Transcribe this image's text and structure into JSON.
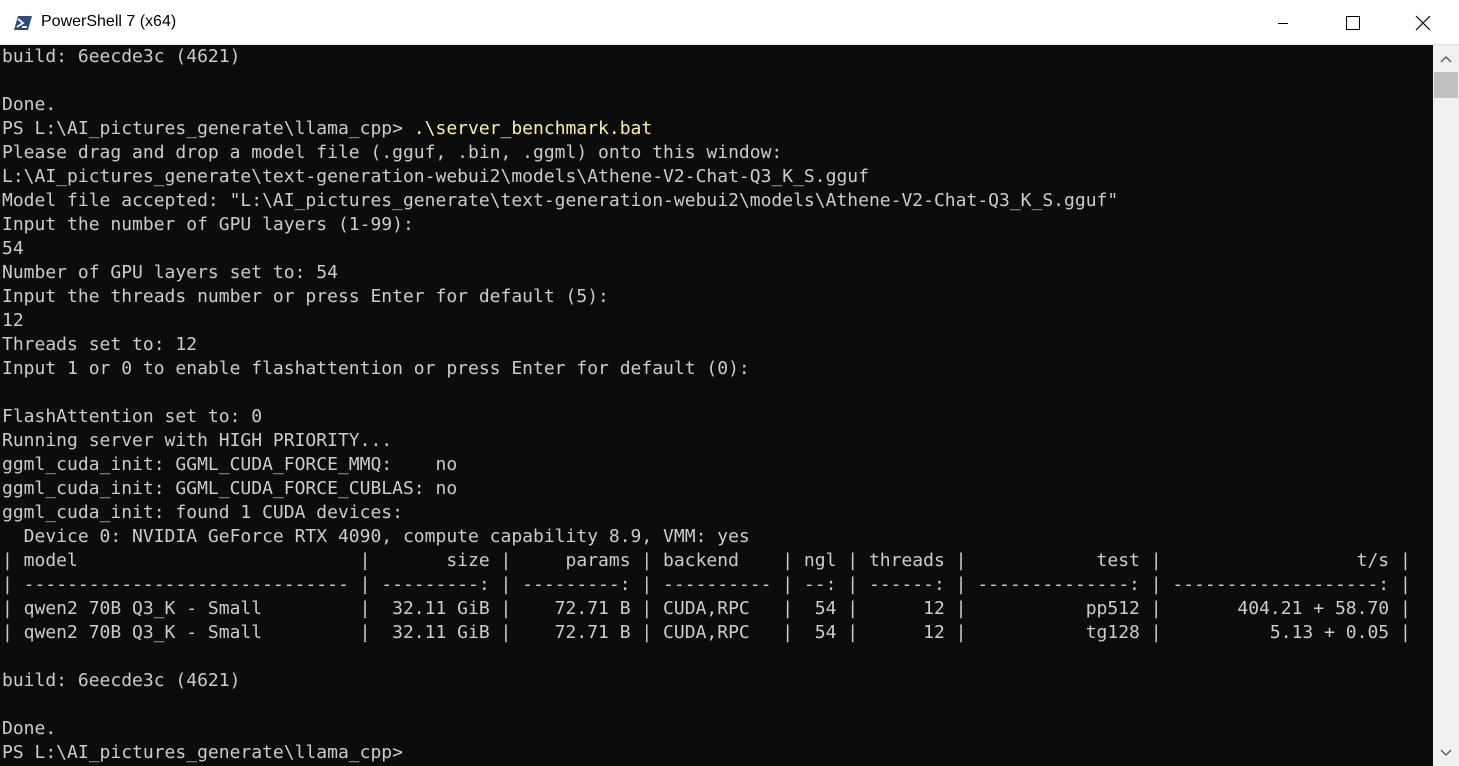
{
  "window": {
    "title": "PowerShell 7 (x64)"
  },
  "icons": {
    "app": "powershell-icon",
    "minimize": "minimize-icon",
    "maximize": "maximize-icon",
    "close": "close-icon"
  },
  "colors": {
    "terminal_bg": "#0c0c0c",
    "terminal_fg": "#cccccc",
    "command_fg": "#f9f1a5"
  },
  "terminal": {
    "lines": [
      "build: 6eecde3c (4621)",
      "",
      "Done.",
      "",
      "Please drag and drop a model file (.gguf, .bin, .ggml) onto this window:",
      "L:\\AI_pictures_generate\\text-generation-webui2\\models\\Athene-V2-Chat-Q3_K_S.gguf",
      "Model file accepted: \"L:\\AI_pictures_generate\\text-generation-webui2\\models\\Athene-V2-Chat-Q3_K_S.gguf\"",
      "Input the number of GPU layers (1-99):",
      "54",
      "Number of GPU layers set to: 54",
      "Input the threads number or press Enter for default (5):",
      "12",
      "Threads set to: 12",
      "Input 1 or 0 to enable flashattention or press Enter for default (0):",
      "",
      "FlashAttention set to: 0",
      "Running server with HIGH PRIORITY...",
      "ggml_cuda_init: GGML_CUDA_FORCE_MMQ:    no",
      "ggml_cuda_init: GGML_CUDA_FORCE_CUBLAS: no",
      "ggml_cuda_init: found 1 CUDA devices:",
      "  Device 0: NVIDIA GeForce RTX 4090, compute capability 8.9, VMM: yes",
      "| model                          |       size |     params | backend    | ngl | threads |            test |                  t/s |",
      "| ------------------------------ | ---------: | ---------: | ---------- | --: | ------: | --------------: | -------------------: |",
      "| qwen2 70B Q3_K - Small         |  32.11 GiB |    72.71 B | CUDA,RPC   |  54 |      12 |           pp512 |       404.21 + 58.70 |",
      "| qwen2 70B Q3_K - Small         |  32.11 GiB |    72.71 B | CUDA,RPC   |  54 |      12 |           tg128 |          5.13 + 0.05 |",
      "",
      "build: 6eecde3c (4621)",
      "",
      "Done.",
      "PS L:\\AI_pictures_generate\\llama_cpp> "
    ],
    "prompt_line": {
      "prompt": "PS L:\\AI_pictures_generate\\llama_cpp> ",
      "command": ".\\server_benchmark.bat"
    }
  }
}
